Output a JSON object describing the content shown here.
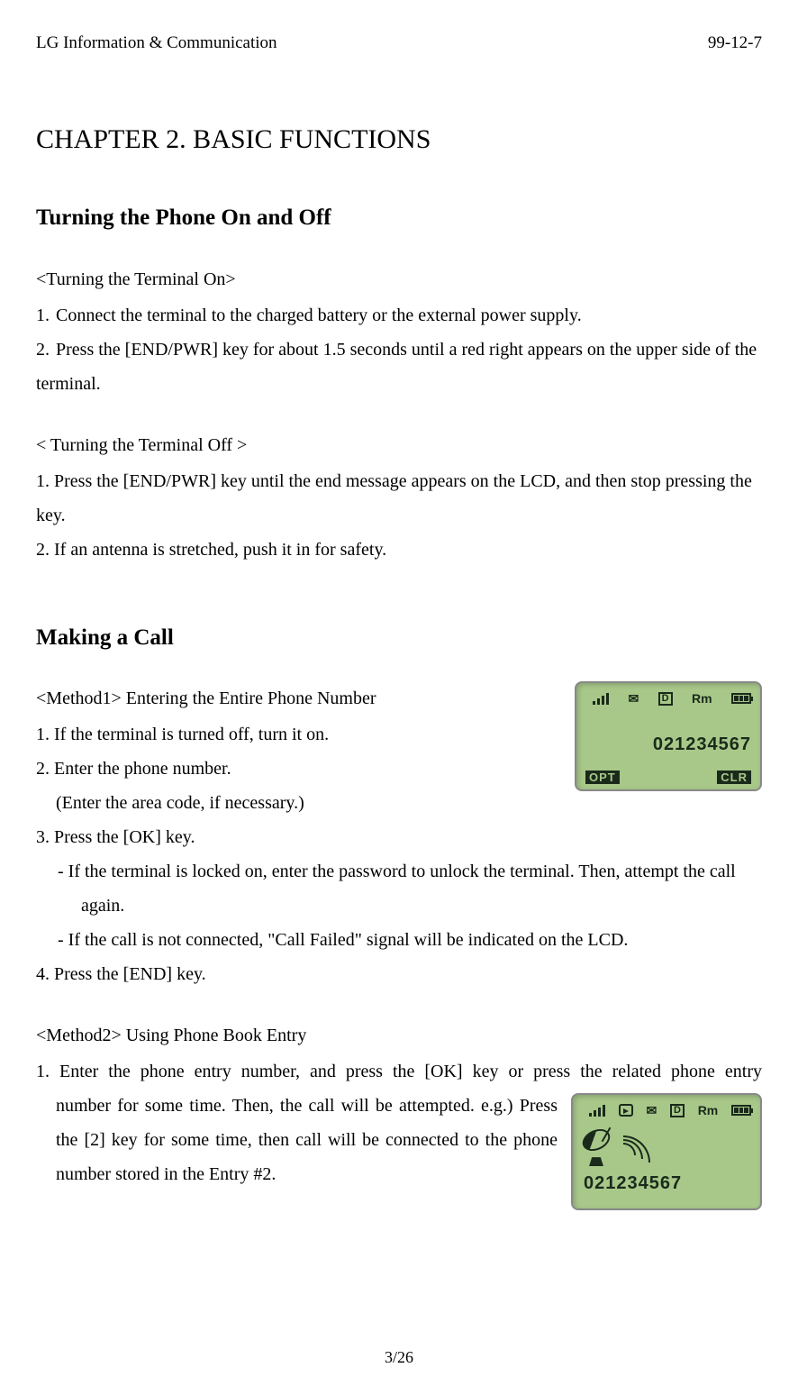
{
  "header": {
    "left": "LG Information & Communication",
    "right": "99-12-7"
  },
  "chapter_title": "CHAPTER 2. BASIC FUNCTIONS",
  "section1": {
    "title": "Turning the Phone On and Off",
    "sub_on": "<Turning the Terminal On>",
    "on_1": "1.",
    "on_1_text": "Connect the terminal to the charged battery or the external power supply.",
    "on_2": "2.",
    "on_2_text": "Press the [END/PWR] key for about 1.5 seconds until a red right appears on the upper side of the terminal.",
    "sub_off": "< Turning the Terminal Off >",
    "off_1": "1. Press the [END/PWR] key until the end message appears on the LCD, and then stop pressing the key.",
    "off_2": "2. If an antenna is stretched, push it in for safety."
  },
  "section2": {
    "title": "Making a Call",
    "method1": "<Method1> Entering the Entire Phone Number",
    "m1_1": "1. If the terminal is turned off, turn it on.",
    "m1_2": "2. Enter the phone number.",
    "m1_2_sub": "(Enter the area code, if necessary.)",
    "m1_3": "3. Press the [OK] key.",
    "m1_3_d1": "-   If the terminal is locked on, enter the password to unlock the terminal. Then, attempt the call again.",
    "m1_3_d2": "-   If the call is not connected, \"Call Failed\" signal will be indicated on the LCD.",
    "m1_4": "4. Press the [END] key.",
    "method2": "<Method2> Using Phone Book Entry",
    "m2_1_line1": "1. Enter the phone entry number, and press the [OK] key or press the related phone entry",
    "m2_1_rest": "number for some time. Then, the call will be attempted. e.g.) Press the [2] key for some time, then call will be connected to the phone number stored in the Entry #2."
  },
  "screens": {
    "number": "021234567",
    "opt": "OPT",
    "clr": "CLR",
    "icons": {
      "env": "✉",
      "d": "D",
      "rm": "Rm"
    }
  },
  "footer": "3/26"
}
